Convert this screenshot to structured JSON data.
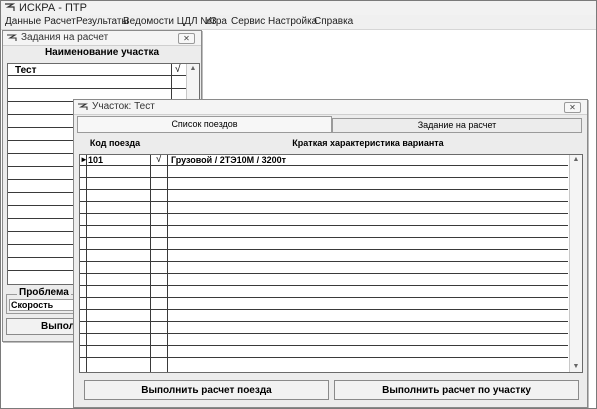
{
  "app": {
    "title": "ИСКРА - ПТР",
    "menu": [
      "Данные",
      "Расчет",
      "Результаты",
      "Ведомости ЦДЛ №3",
      "Игра",
      "Сервис",
      "Настройка",
      "Справка"
    ]
  },
  "tasks_window": {
    "title": "Задания на расчет",
    "close_glyph": "✕",
    "header": "Наименование участка",
    "check_header": "√",
    "first_row": "Тест",
    "problem_label": "Проблема",
    "problem_value": "Скорость",
    "run_button": "Выполн"
  },
  "section_window": {
    "title": "Участок: Тест",
    "close_glyph": "✕",
    "tabs": [
      {
        "label": "Список поездов"
      },
      {
        "label": "Задание на расчет"
      }
    ],
    "table": {
      "columns": [
        "Код поезда",
        "",
        "Краткая характеристика варианта"
      ],
      "rows": [
        {
          "marker": "►",
          "code": "101",
          "check": "√",
          "description": "Грузовой / 2ТЭ10М / 3200т"
        }
      ]
    },
    "buttons": {
      "run_train": "Выполнить расчет поезда",
      "run_section": "Выполнить расчет по участку"
    }
  },
  "scroll_glyphs": {
    "up": "▲",
    "down": "▼"
  }
}
